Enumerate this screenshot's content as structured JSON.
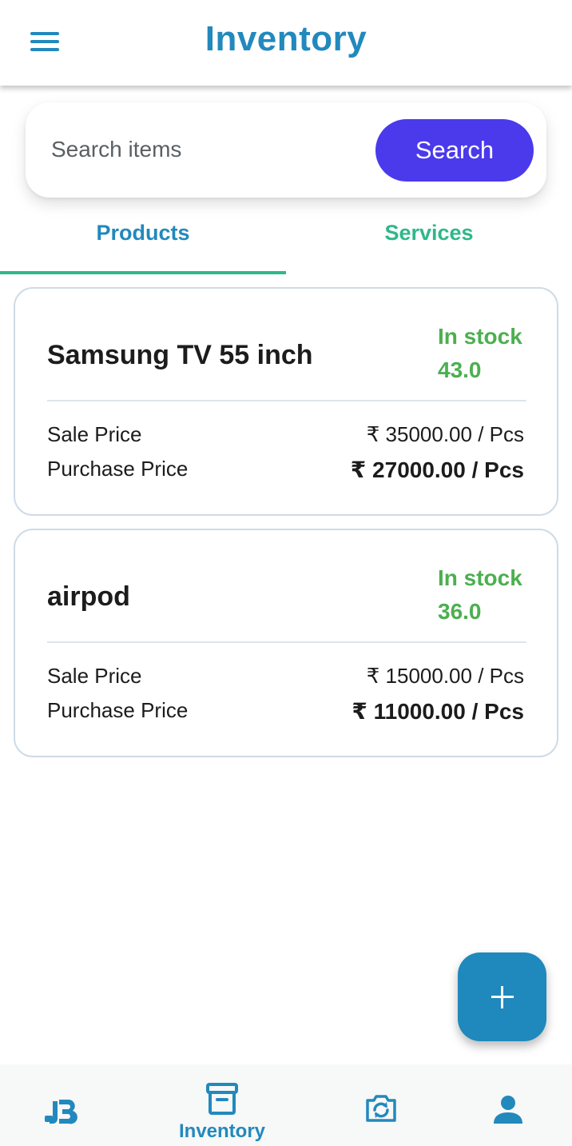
{
  "colors": {
    "primary": "#2289bd",
    "search_button": "#4a3aec",
    "tab_active_text": "#2289bd",
    "tab_inactive_text": "#2eb88a",
    "tab_indicator": "#2eb88a",
    "in_stock": "#4caf50",
    "fab": "#1f88bd"
  },
  "header": {
    "menu_icon": "hamburger-menu-icon",
    "title": "Inventory"
  },
  "search": {
    "placeholder": "Search items",
    "button_label": "Search"
  },
  "tabs": [
    {
      "label": "Products",
      "active": true
    },
    {
      "label": "Services",
      "active": false
    }
  ],
  "products": [
    {
      "name": "Samsung TV 55 inch",
      "stock_label": "In stock",
      "stock_value": "43.0",
      "sale_label": "Sale Price",
      "sale_value": "₹ 35000.00 / Pcs",
      "purchase_label": "Purchase Price",
      "purchase_value": "₹ 27000.00 / Pcs"
    },
    {
      "name": "airpod",
      "stock_label": "In stock",
      "stock_value": "36.0",
      "sale_label": "Sale Price",
      "sale_value": "₹ 15000.00 / Pcs",
      "purchase_label": "Purchase Price",
      "purchase_value": "₹ 11000.00 / Pcs"
    }
  ],
  "fab": {
    "icon": "plus-icon"
  },
  "bottom_nav": {
    "items": [
      {
        "icon": "jb-logo-icon",
        "label": ""
      },
      {
        "icon": "archive-box-icon",
        "label": "Inventory"
      },
      {
        "icon": "camera-switch-icon",
        "label": ""
      },
      {
        "icon": "user-icon",
        "label": ""
      }
    ]
  }
}
